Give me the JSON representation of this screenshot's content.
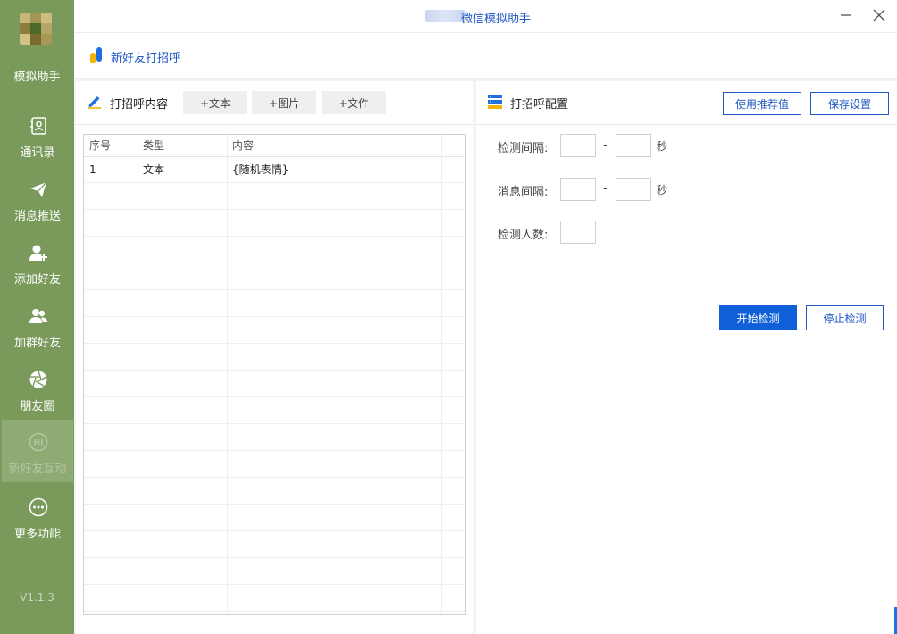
{
  "sidebar": {
    "app_name": "模拟助手",
    "items": [
      {
        "label": "通讯录",
        "icon": "contacts-icon"
      },
      {
        "label": "消息推送",
        "icon": "send-icon"
      },
      {
        "label": "添加好友",
        "icon": "add-user-icon"
      },
      {
        "label": "加群好友",
        "icon": "group-icon"
      },
      {
        "label": "朋友圈",
        "icon": "aperture-icon"
      },
      {
        "label": "新好友互动",
        "icon": "hi-icon",
        "active": true
      },
      {
        "label": "更多功能",
        "icon": "more-icon"
      }
    ],
    "version": "V1.1.3"
  },
  "titlebar": {
    "title": "微信模拟助手"
  },
  "page": {
    "title": "新好友打招呼"
  },
  "greeting_content": {
    "title": "打招呼内容",
    "buttons": {
      "add_text": "+文本",
      "add_image": "+图片",
      "add_file": "+文件"
    },
    "table": {
      "headers": [
        "序号",
        "类型",
        "内容"
      ],
      "rows": [
        {
          "index": "1",
          "type": "文本",
          "content": "{随机表情}"
        }
      ]
    }
  },
  "greeting_config": {
    "title": "打招呼配置",
    "use_recommended": "使用推荐值",
    "save_settings": "保存设置",
    "check_interval_label": "检测间隔:",
    "message_interval_label": "消息间隔:",
    "check_count_label": "检测人数:",
    "dash": "-",
    "unit_seconds": "秒",
    "start_check": "开始检测",
    "stop_check": "停止检测"
  },
  "colors": {
    "sidebar_bg": "#7a9a5c",
    "accent": "#1f57c3",
    "primary_button": "#0e5fd8"
  }
}
